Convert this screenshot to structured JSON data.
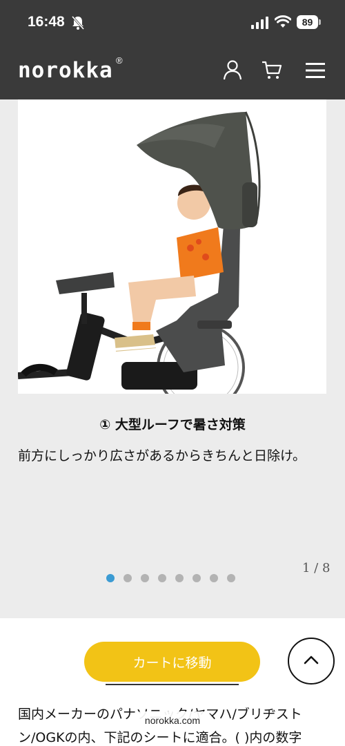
{
  "status_bar": {
    "time": "16:48",
    "battery": "89"
  },
  "header": {
    "logo": "norokka",
    "logo_mark": "®"
  },
  "product": {
    "image_icon": "bike-seat-photo",
    "slide_title": "① 大型ルーフで暑さ対策",
    "slide_description": "前方にしっかり広さがあるからきちんと日除け。",
    "counter": "1 / 8",
    "dots_count": 8,
    "active_dot": 0
  },
  "actions": {
    "cart_button_label": "カートに移動"
  },
  "body_text": "国内メーカーのパナソニック/ヤマハ/ブリヂストン/OGKの内、下記のシートに適合。( )内の数字",
  "browser": {
    "url": "norokka.com"
  },
  "colors": {
    "header_bg": "#3a3a3a",
    "cart_button": "#f2c316",
    "active_dot": "#3b9bd3"
  }
}
